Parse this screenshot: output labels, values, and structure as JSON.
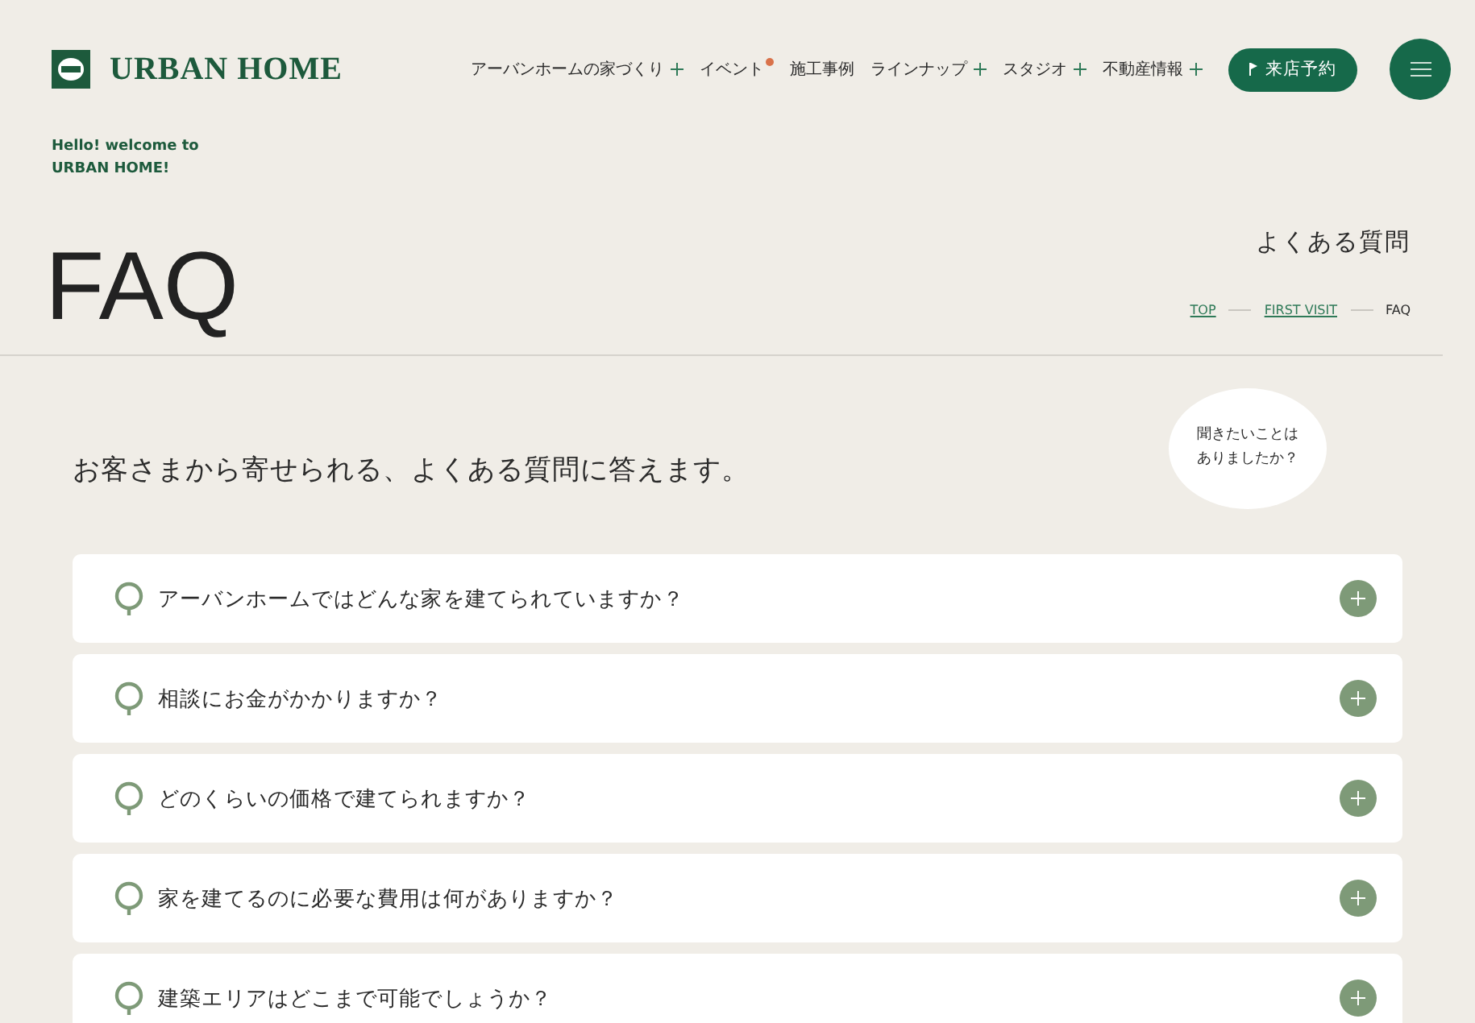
{
  "header": {
    "logo": "URBAN HOME",
    "nav": [
      {
        "label": "アーバンホームの家づくり",
        "has_submenu": true,
        "badge": false
      },
      {
        "label": "イベント",
        "has_submenu": false,
        "badge": true
      },
      {
        "label": "施工事例",
        "has_submenu": false,
        "badge": false
      },
      {
        "label": "ラインナップ",
        "has_submenu": true,
        "badge": false
      },
      {
        "label": "スタジオ",
        "has_submenu": true,
        "badge": false
      },
      {
        "label": "不動産情報",
        "has_submenu": true,
        "badge": false
      }
    ],
    "cta": "来店予約"
  },
  "welcome": [
    "Hello! welcome to",
    "URBAN HOME!"
  ],
  "page_title": "FAQ",
  "page_subtitle": "よくある質問",
  "breadcrumbs": [
    {
      "label": "TOP",
      "link": true
    },
    {
      "label": "FIRST VISIT",
      "link": true
    },
    {
      "label": "FAQ",
      "link": false
    }
  ],
  "lead": "お客さまから寄せられる、よくある質問に答えます。",
  "bubble": [
    "聞きたいことは",
    "ありましたか？"
  ],
  "faqs": [
    {
      "question": "アーバンホームではどんな家を建てられていますか？",
      "expanded": false
    },
    {
      "question": "相談にお金がかかりますか？",
      "expanded": false
    },
    {
      "question": "どのくらいの価格で建てられますか？",
      "expanded": false
    },
    {
      "question": "家を建てるのに必要な費用は何がありますか？",
      "expanded": false
    },
    {
      "question": "建築エリアはどこまで可能でしょうか？",
      "expanded": false
    }
  ]
}
